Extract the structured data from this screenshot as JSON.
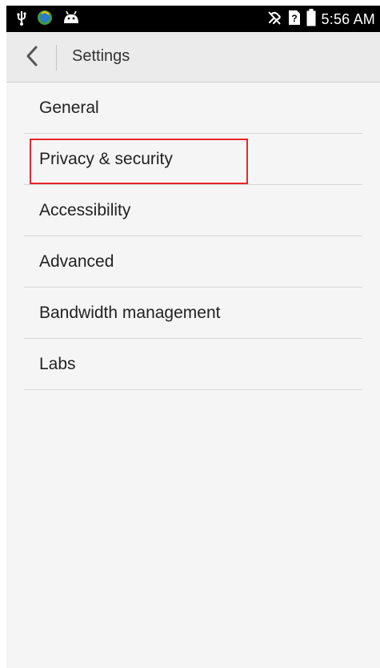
{
  "status_bar": {
    "left_icons": [
      "usb-icon",
      "browser-app-icon",
      "android-debug-icon"
    ],
    "right_icons": [
      "mute-icon",
      "no-sim-icon",
      "battery-icon"
    ],
    "time": "5:56 AM"
  },
  "app_bar": {
    "back_icon": "chevron-left-icon",
    "title": "Settings"
  },
  "settings_list": {
    "items": [
      {
        "label": "General"
      },
      {
        "label": "Privacy & security"
      },
      {
        "label": "Accessibility"
      },
      {
        "label": "Advanced"
      },
      {
        "label": "Bandwidth management"
      },
      {
        "label": "Labs"
      }
    ]
  },
  "annotation": {
    "highlight_color": "#e8262a",
    "highlighted_item": 1
  }
}
